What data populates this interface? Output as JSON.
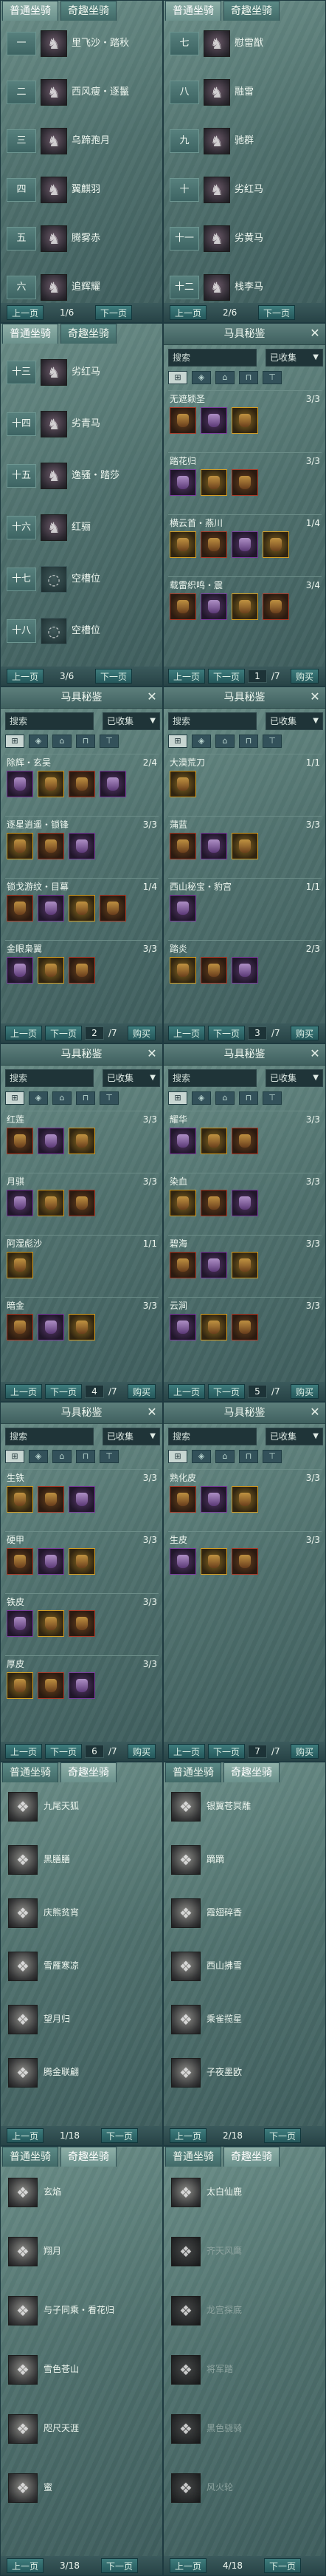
{
  "tabs": {
    "normal": "普通坐骑",
    "rare": "奇趣坐骑"
  },
  "buttons": {
    "prev": "上一页",
    "next": "下一页",
    "buy": "购买"
  },
  "rank_labels": [
    "一",
    "二",
    "三",
    "四",
    "五",
    "六",
    "七",
    "八",
    "九",
    "十",
    "十一",
    "十二",
    "十三",
    "十四",
    "十五",
    "十六",
    "十七",
    "十八"
  ],
  "mount_list": [
    {
      "page": "1/6",
      "left": [
        "里飞沙・踏秋",
        "西风瘦・逐鬣",
        "乌蹄孢月",
        "翼麒羽",
        "腾雾赤",
        "追辉耀"
      ],
      "right": [
        "慰雷猷",
        "融雷",
        "驰群",
        "劣红马",
        "劣黄马",
        "栈李马"
      ],
      "right_page": "2/6"
    },
    {
      "page": "3/6",
      "left": [
        "劣红马",
        "劣青马",
        "逸骚・踏莎",
        "红骊",
        "空槽位",
        "空槽位"
      ],
      "ctrl": [
        "上一页",
        "下一页"
      ]
    }
  ],
  "gear": {
    "title": "马具秘鉴",
    "search": "搜索",
    "filter": "已收集",
    "filter_icons": [
      "全",
      "首",
      "鞍",
      "蹬",
      "辔"
    ],
    "pages": [
      {
        "sets": [
          {
            "name": "无遮颖圣",
            "count": "3/3"
          },
          {
            "name": "踏花归",
            "count": "3/3"
          },
          {
            "name": "横云首・燕川",
            "count": "1/4"
          },
          {
            "name": "载雷织鸣・震",
            "count": "3/4"
          }
        ],
        "page": "1",
        "total": "/7"
      },
      {
        "sets": [
          {
            "name": "除辉・玄吴",
            "count": "2/4"
          },
          {
            "name": "逐星逍遥・锁锋",
            "count": "3/3"
          },
          {
            "name": "锁戈游纹・目幕",
            "count": "1/4"
          },
          {
            "name": "金眼枭翼",
            "count": "3/3"
          }
        ],
        "page": "2",
        "total": "/7"
      },
      {
        "sets": [
          {
            "name": "大漠荒刀",
            "count": "1/1"
          },
          {
            "name": "蒲蓝",
            "count": "3/3"
          },
          {
            "name": "西山秘宝・豹宫",
            "count": "1/1"
          },
          {
            "name": "踏炎",
            "count": "2/3"
          }
        ],
        "page": "3",
        "total": "/7"
      },
      {
        "sets": [
          {
            "name": "红莲",
            "count": "3/3"
          },
          {
            "name": "月骐",
            "count": "3/3"
          },
          {
            "name": "阿湿彪沙",
            "count": "1/1"
          },
          {
            "name": "暗金",
            "count": "3/3"
          }
        ],
        "page": "4",
        "total": "/7"
      },
      {
        "sets": [
          {
            "name": "耀华",
            "count": "3/3"
          },
          {
            "name": "染血",
            "count": "3/3"
          },
          {
            "name": "碧海",
            "count": "3/3"
          },
          {
            "name": "云涧",
            "count": "3/3"
          }
        ],
        "page": "5",
        "total": "/7"
      },
      {
        "sets": [
          {
            "name": "生铁",
            "count": "3/3"
          },
          {
            "name": "硬甲",
            "count": "3/3"
          },
          {
            "name": "铁皮",
            "count": "3/3"
          },
          {
            "name": "厚皮",
            "count": "3/3"
          }
        ],
        "page": "6",
        "total": "/7"
      },
      {
        "sets": [
          {
            "name": "熟化皮",
            "count": "3/3"
          },
          {
            "name": "生皮",
            "count": "3/3"
          }
        ],
        "page": "7",
        "total": "/7"
      }
    ]
  },
  "pets": [
    {
      "left": [
        "九尾天狐",
        "黑膳膳",
        "庆熊贫宵",
        "雪雁寒凉",
        "望月归",
        "腾金联翩"
      ],
      "right": [
        "银翼苍冥雕",
        "蹢蹢",
        "霞翅碎香",
        "西山拂雪",
        "乘雀揽星",
        "子夜墨欧"
      ],
      "left_page": "1/18",
      "right_page": "2/18"
    },
    {
      "left": [
        "玄焰",
        "翔月",
        "与子同乘・看花归",
        "雪色苍山",
        "咫尺天涯",
        "蜜"
      ],
      "right": [
        "太白仙鹿",
        "齐天风鹰",
        "龙宫探底",
        "将军踏",
        "黑色骁骑",
        "风火轮"
      ],
      "left_page": "3/18",
      "right_page": "4/18"
    }
  ]
}
